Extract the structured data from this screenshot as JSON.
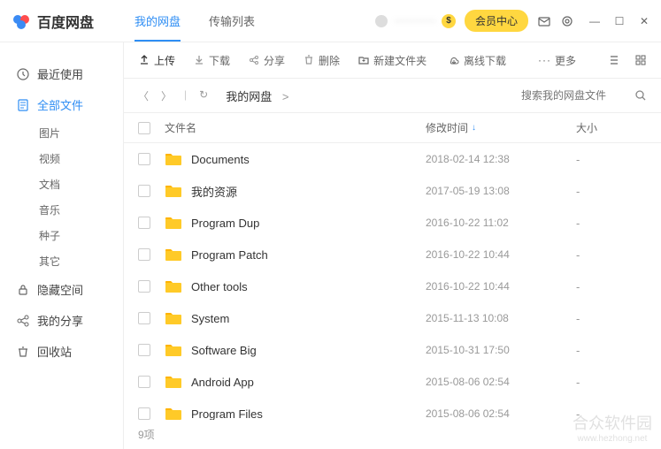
{
  "app": {
    "name": "百度网盘"
  },
  "tabs": {
    "mydisk": "我的网盘",
    "transfer": "传输列表"
  },
  "titlebar": {
    "username": "·············",
    "member": "会员中心"
  },
  "sidebar": {
    "recent": "最近使用",
    "all": "全部文件",
    "subs": [
      "图片",
      "视频",
      "文档",
      "音乐",
      "种子",
      "其它"
    ],
    "hidden": "隐藏空间",
    "share": "我的分享",
    "trash": "回收站"
  },
  "toolbar": {
    "upload": "上传",
    "download": "下载",
    "share": "分享",
    "delete": "删除",
    "newfolder": "新建文件夹",
    "offline": "离线下载",
    "more": "更多"
  },
  "breadcrumb": {
    "root": "我的网盘",
    "sep": ">"
  },
  "search": {
    "placeholder": "搜索我的网盘文件"
  },
  "columns": {
    "name": "文件名",
    "date": "修改时间",
    "size": "大小"
  },
  "files": [
    {
      "name": "Documents",
      "date": "2018-02-14 12:38",
      "size": "-"
    },
    {
      "name": "我的资源",
      "date": "2017-05-19 13:08",
      "size": "-"
    },
    {
      "name": "Program Dup",
      "date": "2016-10-22 11:02",
      "size": "-"
    },
    {
      "name": "Program Patch",
      "date": "2016-10-22 10:44",
      "size": "-"
    },
    {
      "name": "Other tools",
      "date": "2016-10-22 10:44",
      "size": "-"
    },
    {
      "name": "System",
      "date": "2015-11-13 10:08",
      "size": "-"
    },
    {
      "name": "Software Big",
      "date": "2015-10-31 17:50",
      "size": "-"
    },
    {
      "name": "Android App",
      "date": "2015-08-06 02:54",
      "size": "-"
    },
    {
      "name": "Program Files",
      "date": "2015-08-06 02:54",
      "size": "-"
    }
  ],
  "footer": {
    "count": "9项"
  },
  "watermark": {
    "main": "合众软件园",
    "sub": "www.hezhong.net"
  }
}
